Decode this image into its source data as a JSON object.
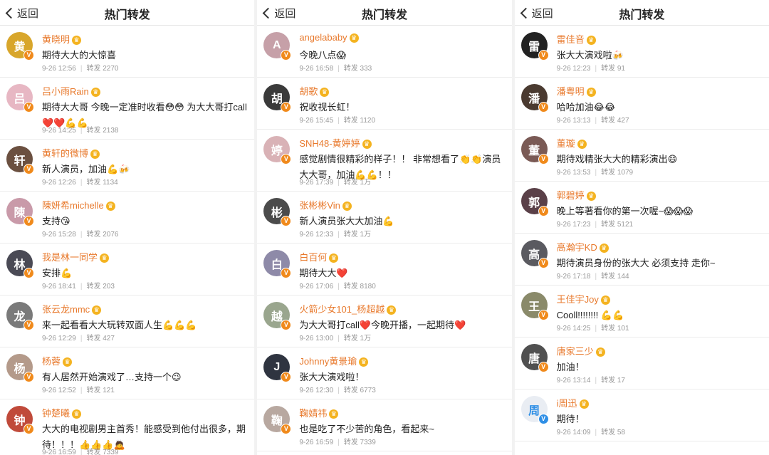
{
  "columns": [
    {
      "back_label": "返回",
      "title": "热门转发",
      "items": [
        {
          "name": "黄晓明",
          "text": "期待大大的大惊喜",
          "time": "9-26 12:56",
          "repost": "转发 2270",
          "avatar_color": "#d8a62b",
          "initial": "黄"
        },
        {
          "name": "吕小雨Rain",
          "text": "期待大大哥 今晚一定准时收看😳😳 为大大哥打call❤️❤️💪💪",
          "time": "9-26 14:25",
          "repost": "转发 2138",
          "avatar_color": "#e7b7c3",
          "initial": "吕"
        },
        {
          "name": "黄轩的微博",
          "text": "新人演员，加油💪🍻",
          "time": "9-26 12:26",
          "repost": "转发 1134",
          "avatar_color": "#6b5040",
          "initial": "轩"
        },
        {
          "name": "陳妍希michelle",
          "text": "支持😘",
          "time": "9-26 15:28",
          "repost": "转发 2076",
          "avatar_color": "#c99aa9",
          "initial": "陳"
        },
        {
          "name": "我是林一同学",
          "text": "安排💪",
          "time": "9-26 18:41",
          "repost": "转发 203",
          "avatar_color": "#4a4a55",
          "initial": "林"
        },
        {
          "name": "张云龙mmc",
          "text": "来一起看看大大玩转双面人生💪💪💪",
          "time": "9-26 12:29",
          "repost": "转发 427",
          "avatar_color": "#7a7a7a",
          "initial": "龙"
        },
        {
          "name": "杨蓉",
          "text": "有人居然开始演戏了…支持一个😉",
          "time": "9-26 12:52",
          "repost": "转发 121",
          "avatar_color": "#b49a8a",
          "initial": "杨"
        },
        {
          "name": "钟楚曦",
          "text": "大大的电视剧男主首秀！能感受到他付出很多，期待！！！👍👍👍🙇",
          "time": "9-26 16:59",
          "repost": "转发 7339",
          "avatar_color": "#c04a3a",
          "initial": "钟"
        }
      ]
    },
    {
      "back_label": "返回",
      "title": "热门转发",
      "items": [
        {
          "name": "angelababy",
          "text": "今晚八点😱",
          "time": "9-26 16:58",
          "repost": "转发 333",
          "avatar_color": "#c6a0a8",
          "initial": "A"
        },
        {
          "name": "胡歌",
          "text": "祝收视长虹！",
          "time": "9-26 15:45",
          "repost": "转发 1120",
          "avatar_color": "#3a3a3a",
          "initial": "胡"
        },
        {
          "name": "SNH48-黄婷婷",
          "text": "感觉剧情很精彩的样子！！ 非常想看了👏👏演员大大哥，加油💪💪！！",
          "time": "9-26 17:39",
          "repost": "转发 1万",
          "avatar_color": "#d9b2b6",
          "initial": "婷"
        },
        {
          "name": "张彬彬Vin",
          "text": "新人演员张大大加油💪",
          "time": "9-26 12:33",
          "repost": "转发 1万",
          "avatar_color": "#4b4b4b",
          "initial": "彬"
        },
        {
          "name": "白百何",
          "text": "期待大大❤️",
          "time": "9-26 17:06",
          "repost": "转发 8180",
          "avatar_color": "#8e8aa8",
          "initial": "白"
        },
        {
          "name": "火箭少女101_杨超越",
          "text": "为大大哥打call❤️今晚开播，一起期待❤️",
          "time": "9-26 13:00",
          "repost": "转发 1万",
          "avatar_color": "#9aa68e",
          "initial": "越"
        },
        {
          "name": "Johnny黄景瑜",
          "text": "张大大演戏啦！",
          "time": "9-26 12:30",
          "repost": "转发 6773",
          "avatar_color": "#2f3440",
          "initial": "J"
        },
        {
          "name": "鞠婧祎",
          "text": "也是吃了不少苦的角色，看起来~",
          "time": "9-26 16:59",
          "repost": "转发 7339",
          "avatar_color": "#b8a8a0",
          "initial": "鞠"
        }
      ]
    },
    {
      "back_label": "返回",
      "title": "热门转发",
      "items": [
        {
          "name": "雷佳音",
          "text": "张大大演戏啦🍻",
          "time": "9-26 12:23",
          "repost": "转发 91",
          "avatar_color": "#222222",
          "initial": "雷"
        },
        {
          "name": "潘粤明",
          "text": "哈哈加油😂😂",
          "time": "9-26 13:13",
          "repost": "转发 427",
          "avatar_color": "#4a3a30",
          "initial": "潘"
        },
        {
          "name": "董璇",
          "text": "期待戏精张大大的精彩演出😄",
          "time": "9-26 13:53",
          "repost": "转发 1079",
          "avatar_color": "#7a5a55",
          "initial": "董"
        },
        {
          "name": "郭碧婷",
          "text": "晚上等著看你的第一次喔~😱😱😱",
          "time": "9-26 17:23",
          "repost": "转发 5121",
          "avatar_color": "#5a4048",
          "initial": "郭"
        },
        {
          "name": "高瀚宇KD",
          "text": "期待演员身份的张大大 必须支持 走你~",
          "time": "9-26 17:18",
          "repost": "转发 144",
          "avatar_color": "#5a5a60",
          "initial": "高"
        },
        {
          "name": "王佳宇Joy",
          "text": "Cooll!!!!!!!! 💪💪",
          "time": "9-26 14:25",
          "repost": "转发 101",
          "avatar_color": "#8a8a6a",
          "initial": "王"
        },
        {
          "name": "唐家三少",
          "text": "加油！",
          "time": "9-26 13:14",
          "repost": "转发 17",
          "avatar_color": "#505050",
          "initial": "唐"
        },
        {
          "name": "i周迅",
          "text": "期待！",
          "time": "9-26 14:09",
          "repost": "转发 58",
          "avatar_color": "#e9edf3",
          "initial": "周",
          "badge_blue": true
        }
      ]
    }
  ],
  "colors": {
    "name": "#e8792c",
    "meta": "#999999",
    "badge": "#f08a1c"
  }
}
